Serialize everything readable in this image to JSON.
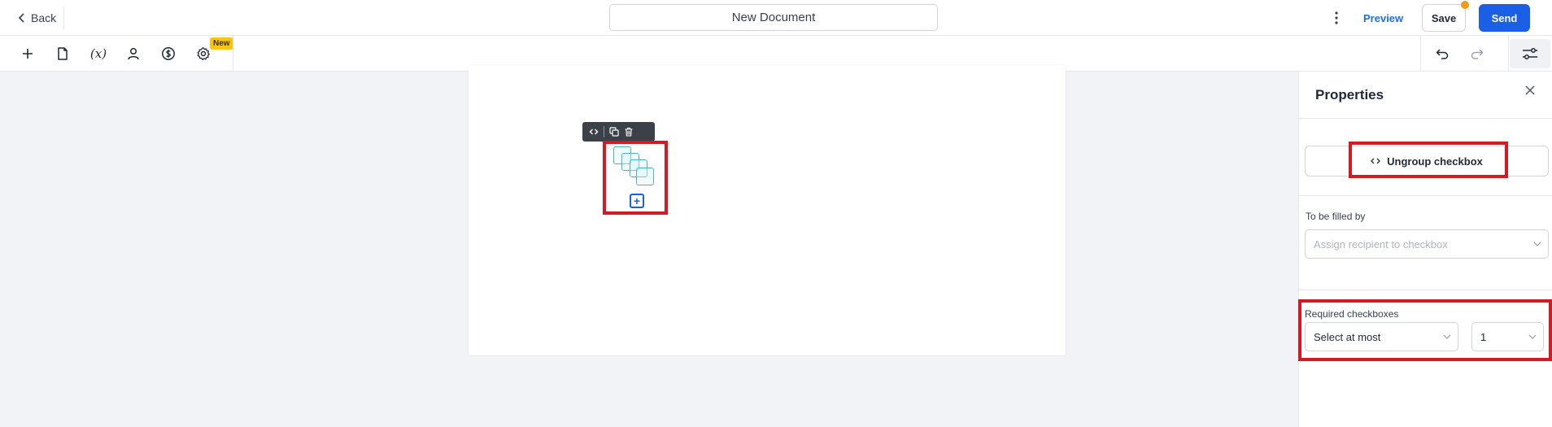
{
  "header": {
    "back_label": "Back",
    "document_title": "New Document",
    "preview_label": "Preview",
    "save_label": "Save",
    "send_label": "Send",
    "save_indicator_color": "#f29a1d",
    "send_color": "#1a5fe6"
  },
  "toolbar": {
    "tools": [
      "plus-icon",
      "document-icon",
      "variable-icon",
      "user-icon",
      "dollar-icon",
      "gear-icon"
    ],
    "variable_label": "(x)",
    "new_badge": "New",
    "right_icons": [
      "undo-icon",
      "redo-icon",
      "settings-toggle-icon"
    ]
  },
  "canvas": {
    "page_actions": [
      "add-page-icon",
      "more-options-icon"
    ],
    "field_toolbar_icons": [
      "ungroup-icon",
      "duplicate-icon",
      "delete-icon"
    ],
    "checkbox_group_count": 4
  },
  "properties": {
    "title": "Properties",
    "ungroup_label": "Ungroup checkbox",
    "filled_by_label": "To be filled by",
    "filled_by_placeholder": "Assign recipient to checkbox",
    "required_label": "Required checkboxes",
    "rule_value": "Select at most",
    "count_value": "1",
    "highlight_color": "#d31b24"
  }
}
